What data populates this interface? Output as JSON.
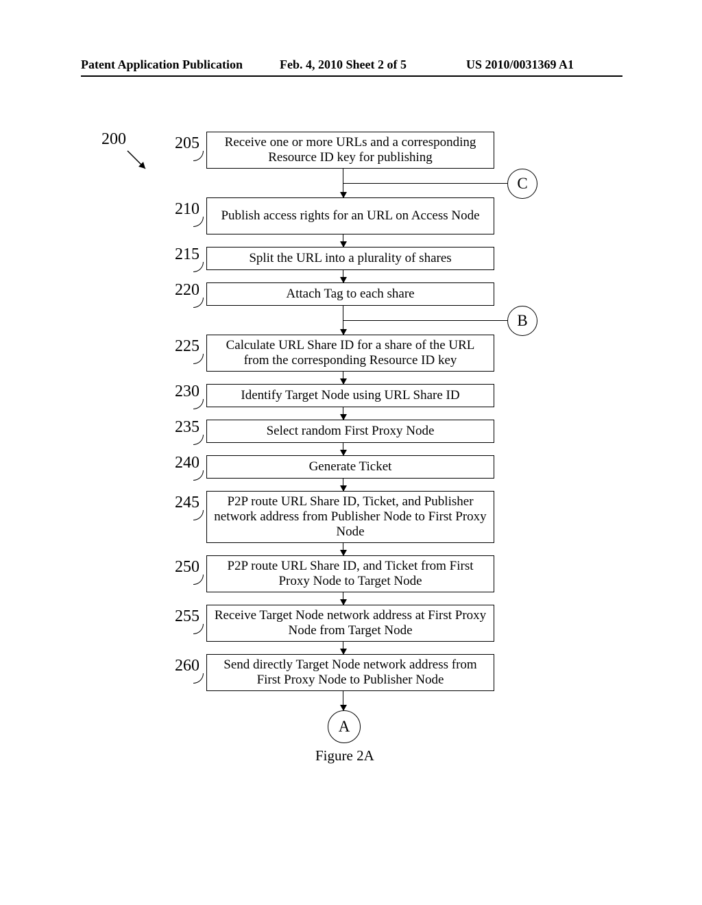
{
  "header": {
    "left": "Patent Application Publication",
    "center": "Feb. 4, 2010  Sheet 2 of 5",
    "right": "US 2010/0031369 A1"
  },
  "figure_ref": "200",
  "steps": [
    {
      "num": "205",
      "text": "Receive one or more URLs and a corresponding Resource ID key for publishing"
    },
    {
      "num": "210",
      "text": "Publish access rights for an URL on Access Node"
    },
    {
      "num": "215",
      "text": "Split the URL into a plurality of shares"
    },
    {
      "num": "220",
      "text": "Attach Tag to each share"
    },
    {
      "num": "225",
      "text": "Calculate URL Share ID for a share of the URL from the corresponding Resource ID key"
    },
    {
      "num": "230",
      "text": "Identify Target Node using URL Share ID"
    },
    {
      "num": "235",
      "text": "Select random First Proxy Node"
    },
    {
      "num": "240",
      "text": "Generate Ticket"
    },
    {
      "num": "245",
      "text": "P2P route URL Share ID, Ticket, and Publisher network address from Publisher Node to First Proxy Node"
    },
    {
      "num": "250",
      "text": "P2P route URL Share ID, and Ticket from First Proxy Node to Target Node"
    },
    {
      "num": "255",
      "text": "Receive Target Node network address at First Proxy Node from Target Node"
    },
    {
      "num": "260",
      "text": "Send directly Target Node network address from First Proxy Node to Publisher Node"
    }
  ],
  "connectors": {
    "A": "A",
    "B": "B",
    "C": "C"
  },
  "caption": "Figure 2A"
}
